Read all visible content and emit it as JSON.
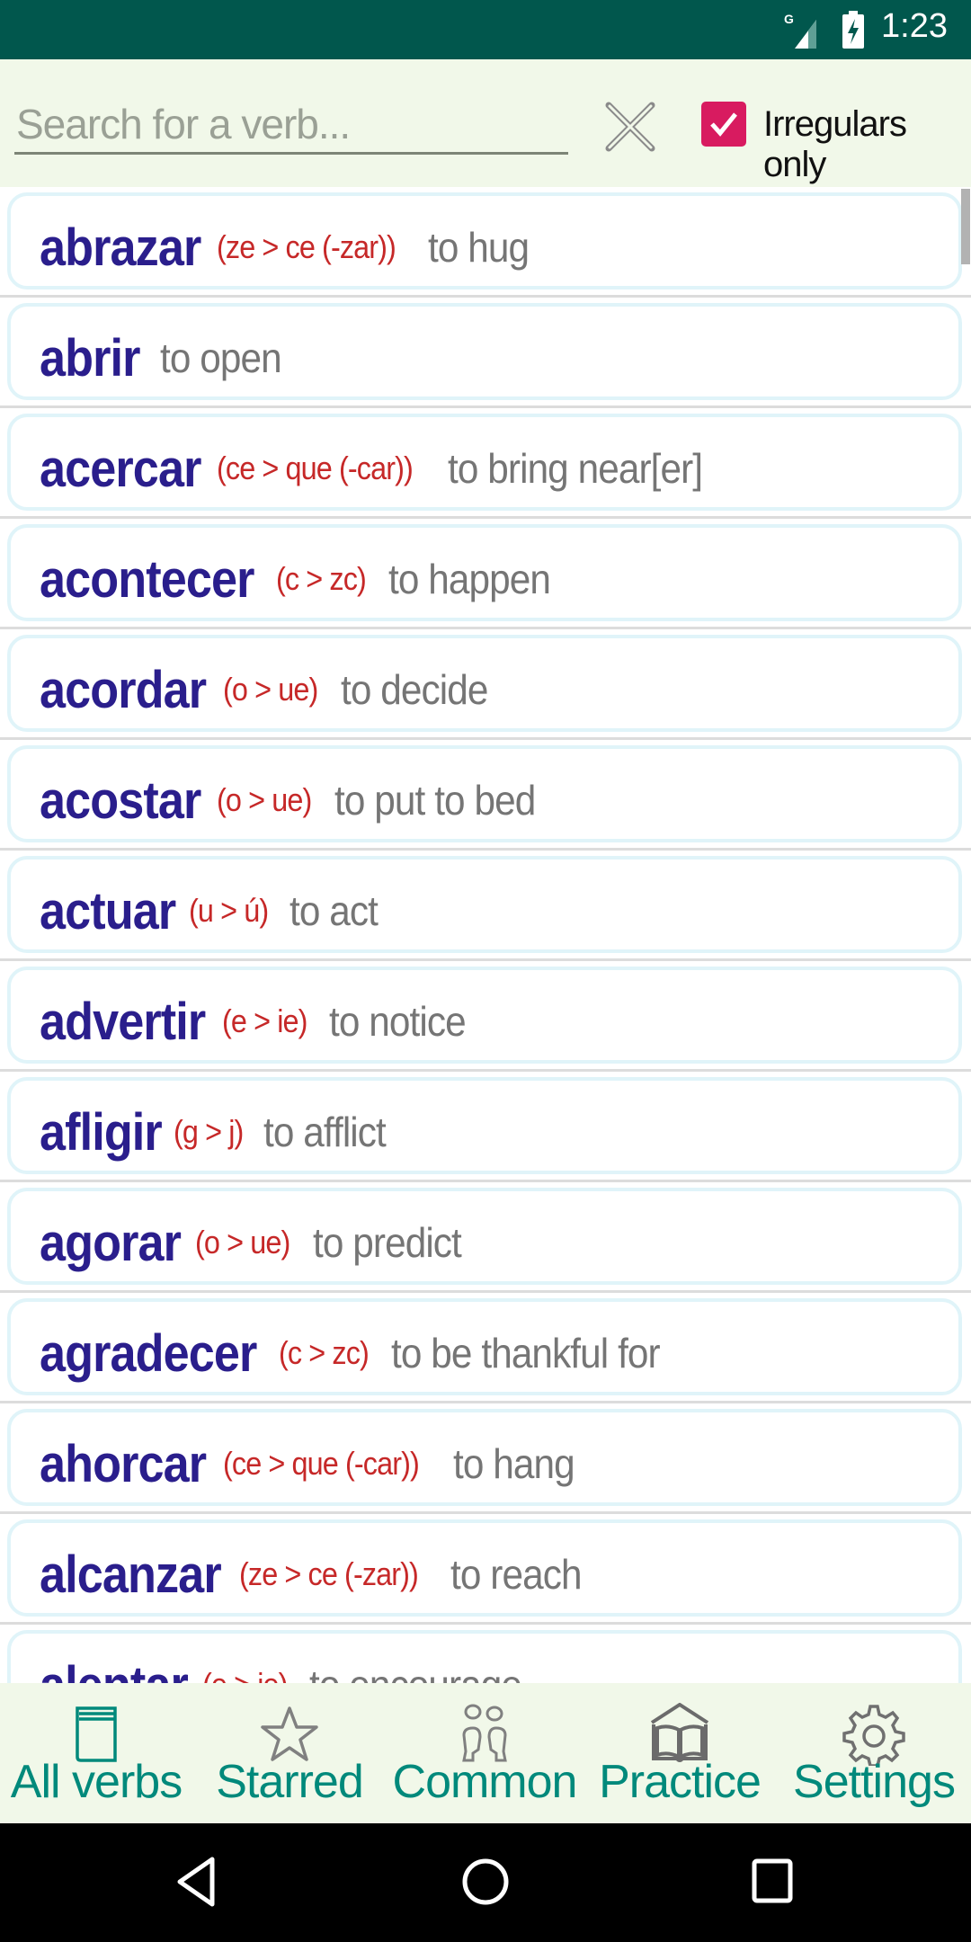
{
  "status_bar": {
    "time": "1:23",
    "network_label": "G",
    "icons": [
      "signal-icon",
      "battery-charging-icon"
    ]
  },
  "search": {
    "placeholder": "Search for a verb...",
    "value": "",
    "clear_icon": "close-icon",
    "irregulars_only_label": "Irregulars only",
    "irregulars_only_checked": true
  },
  "colors": {
    "status_bar": "#01574D",
    "header_bg": "#F1F8E9",
    "verb": "#2A1E8C",
    "pattern": "#C62828",
    "meaning": "#757575",
    "nav_label": "#00897B",
    "checkbox": "#D81B60"
  },
  "verbs": [
    {
      "verb": "abrazar",
      "pattern": "(ze > ce (-zar))",
      "meaning": "to hug"
    },
    {
      "verb": "abrir",
      "pattern": "",
      "meaning": "to open"
    },
    {
      "verb": "acercar",
      "pattern": "(ce > que (-car))",
      "meaning": "to bring near[er]"
    },
    {
      "verb": "acontecer",
      "pattern": "(c > zc)",
      "meaning": "to happen"
    },
    {
      "verb": "acordar",
      "pattern": "(o > ue)",
      "meaning": "to decide"
    },
    {
      "verb": "acostar",
      "pattern": "(o > ue)",
      "meaning": "to put to bed"
    },
    {
      "verb": "actuar",
      "pattern": "(u > ú)",
      "meaning": "to act"
    },
    {
      "verb": "advertir",
      "pattern": "(e > ie)",
      "meaning": "to notice"
    },
    {
      "verb": "afligir",
      "pattern": "(g > j)",
      "meaning": "to afflict"
    },
    {
      "verb": "agorar",
      "pattern": "(o > ue)",
      "meaning": "to predict"
    },
    {
      "verb": "agradecer",
      "pattern": "(c > zc)",
      "meaning": "to be thankful for"
    },
    {
      "verb": "ahorcar",
      "pattern": "(ce > que (-car))",
      "meaning": "to hang"
    },
    {
      "verb": "alcanzar",
      "pattern": "(ze > ce (-zar))",
      "meaning": "to reach"
    },
    {
      "verb": "alentar",
      "pattern": "(e > ie)",
      "meaning": "to encourage"
    }
  ],
  "bottom_nav": {
    "items": [
      {
        "label": "All verbs",
        "icon": "book-icon",
        "active": true
      },
      {
        "label": "Starred",
        "icon": "star-icon",
        "active": false
      },
      {
        "label": "Common",
        "icon": "conversation-icon",
        "active": false
      },
      {
        "label": "Practice",
        "icon": "open-book-icon",
        "active": false
      },
      {
        "label": "Settings",
        "icon": "gear-icon",
        "active": false
      }
    ]
  },
  "system_nav": {
    "buttons": [
      "back-icon",
      "home-icon",
      "recents-icon"
    ]
  }
}
